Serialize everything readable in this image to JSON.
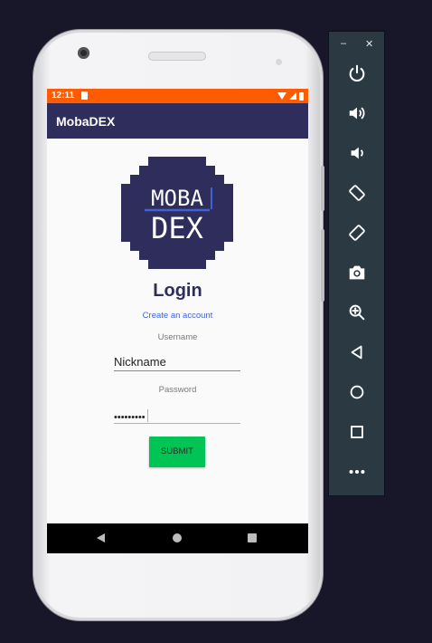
{
  "status_bar": {
    "time": "12:11"
  },
  "app_bar": {
    "title": "MobaDEX"
  },
  "logo": {
    "line1": "MOBA",
    "line2": "DEX",
    "background": "#2e2d5b",
    "underline": "#3f63d4"
  },
  "login": {
    "heading": "Login",
    "create_account": "Create an account",
    "username_label": "Username",
    "username_value": "Nickname",
    "password_label": "Password",
    "password_value": "•••••••••",
    "submit_label": "SUBMIT"
  },
  "emulator_toolbar": {
    "minimize": "–",
    "close": "✕",
    "buttons": [
      "power-icon",
      "volume-up-icon",
      "volume-down-icon",
      "rotate-left-icon",
      "rotate-right-icon",
      "camera-icon",
      "zoom-icon",
      "back-icon",
      "home-icon",
      "overview-icon",
      "more-icon"
    ]
  },
  "colors": {
    "status_bar": "#ff5b00",
    "app_bar": "#2e2d5b",
    "submit": "#00c455",
    "link": "#3f63d4",
    "focus": "#f3b400"
  }
}
